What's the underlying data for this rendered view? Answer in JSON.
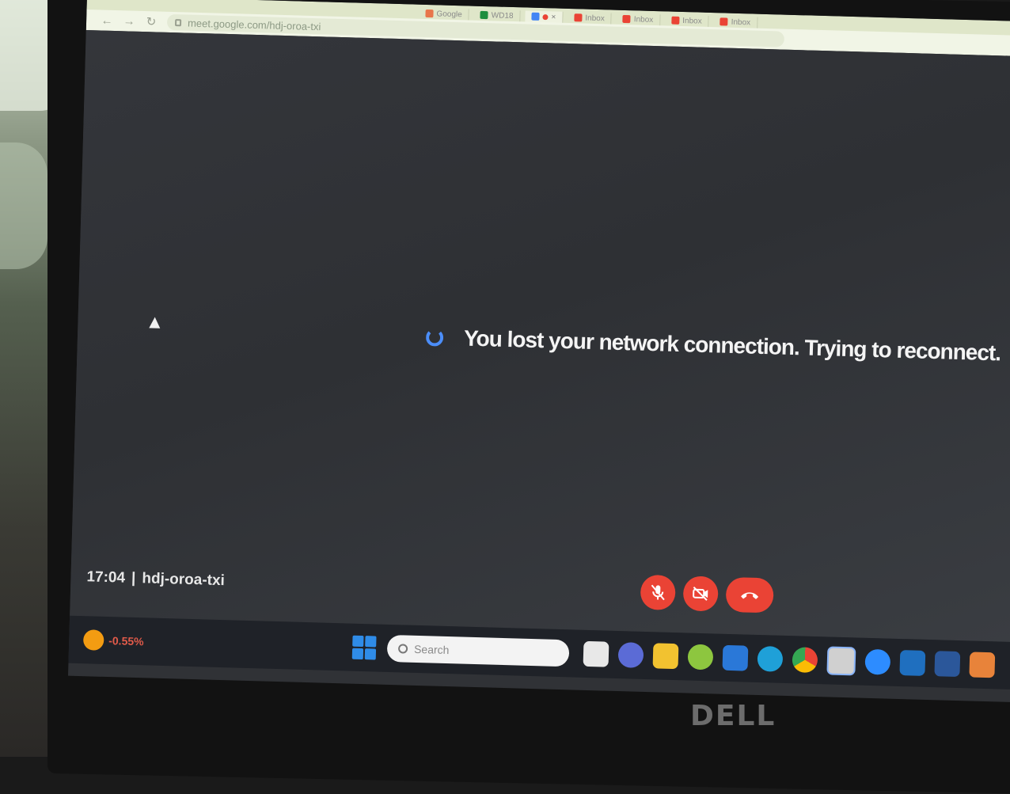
{
  "browser": {
    "tabs": [
      {
        "label": "Google",
        "color": "#e8754a",
        "active": false
      },
      {
        "label": "WD18",
        "color": "#1e8e3e",
        "active": false
      },
      {
        "label": "",
        "color": "#4285f4",
        "active": true
      },
      {
        "label": "Inbox",
        "color": "#ea4335",
        "active": false
      },
      {
        "label": "Inbox",
        "color": "#ea4335",
        "active": false
      },
      {
        "label": "Inbox",
        "color": "#ea4335",
        "active": false
      },
      {
        "label": "Inbox",
        "color": "#ea4335",
        "active": false
      }
    ],
    "url": "meet.google.com/hdj-oroa-txi"
  },
  "meet": {
    "reconnect_message": "You lost your network connection. Trying to reconnect.",
    "time": "17:04",
    "separator": "|",
    "meeting_code": "hdj-oroa-txi",
    "controls": [
      {
        "icon": "mic-off-icon"
      },
      {
        "icon": "camera-off-icon"
      },
      {
        "icon": "hang-up-icon"
      }
    ],
    "accent_color": "#ea4335"
  },
  "taskbar": {
    "weather_text": "-0.55%",
    "search_placeholder": "Search",
    "apps": [
      {
        "icon": "task-view-icon"
      },
      {
        "icon": "chat-icon"
      },
      {
        "icon": "file-explorer-icon"
      },
      {
        "icon": "app-icon"
      },
      {
        "icon": "store-icon"
      },
      {
        "icon": "edge-icon"
      },
      {
        "icon": "chrome-icon"
      },
      {
        "icon": "chrome-profile-icon"
      },
      {
        "icon": "zoom-icon"
      },
      {
        "icon": "vscode-icon"
      },
      {
        "icon": "word-icon"
      },
      {
        "icon": "app-icon"
      }
    ]
  },
  "monitor": {
    "brand": "DELL"
  }
}
